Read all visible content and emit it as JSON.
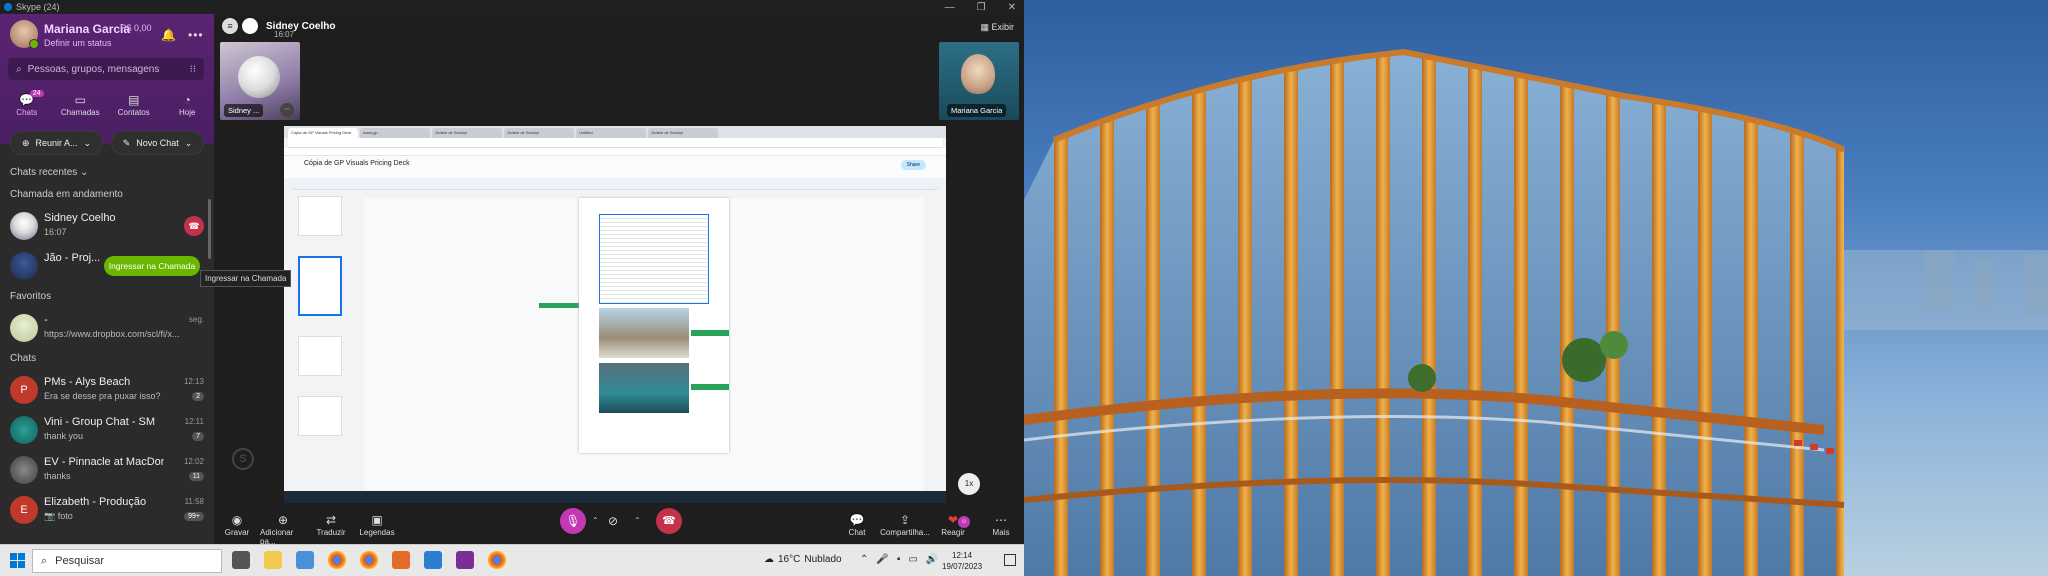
{
  "window": {
    "title": "Skype (24)",
    "controls": [
      "—",
      "❐",
      "✕"
    ]
  },
  "profile": {
    "name": "Mariana Garcia",
    "credit": "R$ 0,00",
    "status": "Definir um status"
  },
  "search": {
    "placeholder": "Pessoas, grupos, mensagens"
  },
  "nav": [
    {
      "label": "Chats",
      "icon": "chat-icon",
      "badge": "24",
      "active": true
    },
    {
      "label": "Chamadas",
      "icon": "video-icon"
    },
    {
      "label": "Contatos",
      "icon": "contacts-icon"
    },
    {
      "label": "Hoje",
      "icon": "today-icon"
    }
  ],
  "actions": {
    "meet": "Reunir A...",
    "new_chat": "Novo Chat"
  },
  "sections": {
    "recent": "Chats recentes",
    "ongoing": "Chamada em andamento",
    "favorites": "Favoritos",
    "chats": "Chats"
  },
  "ongoing_calls": [
    {
      "title": "Sidney Coelho",
      "sub": "16:07"
    },
    {
      "title": "Jão - Proj...",
      "join_label": "Ingressar na Chamada"
    }
  ],
  "tooltip": "Ingressar na Chamada",
  "favorites": [
    {
      "title": "-",
      "sub": "https://www.dropbox.com/scl/fi/x...",
      "time": "seg."
    }
  ],
  "chats": [
    {
      "title": "PMs - Alys Beach",
      "sub": "Era se desse pra puxar isso?",
      "time": "12:13",
      "badge": "2"
    },
    {
      "title": "Vini - Group Chat - SM",
      "sub": "thank you",
      "time": "12:11",
      "badge": "7"
    },
    {
      "title": "EV - Pinnacle at MacDon...",
      "sub": "thanks",
      "time": "12:02",
      "badge": "11"
    },
    {
      "title": "Elizabeth - Produção",
      "sub": "foto",
      "time": "11:58",
      "badge": "99+"
    }
  ],
  "call": {
    "caller": "Sidney Coelho",
    "time": "16:07",
    "view_label": "Exibir",
    "thumb_left": "Sidney ...",
    "thumb_right": "Mariana Garcia",
    "zoom": "1x"
  },
  "shared_screen": {
    "doc_title": "Cópia de GP Visuals Pricing Deck",
    "share_label": "Share",
    "tabs": [
      "Cópia de GP Visuals Pricing Deck",
      "www.gp...",
      "Ordem de Serviço",
      "Ordem de Serviço",
      "Untitled",
      "Ordem de Serviço"
    ]
  },
  "controls": {
    "record": "Gravar",
    "add": "Adicionar pa...",
    "translate": "Traduzir",
    "captions": "Legendas",
    "chat": "Chat",
    "share": "Compartilha...",
    "react": "Reagir",
    "more": "Mais"
  },
  "taskbar": {
    "search": "Pesquisar",
    "weather_temp": "16°C",
    "weather_desc": "Nublado",
    "time": "12:14",
    "date": "19/07/2023"
  },
  "colors": {
    "profile_bg": "#4a1f63",
    "accent": "#c239b3",
    "join": "#6bb700",
    "hangup": "#c4314b"
  }
}
